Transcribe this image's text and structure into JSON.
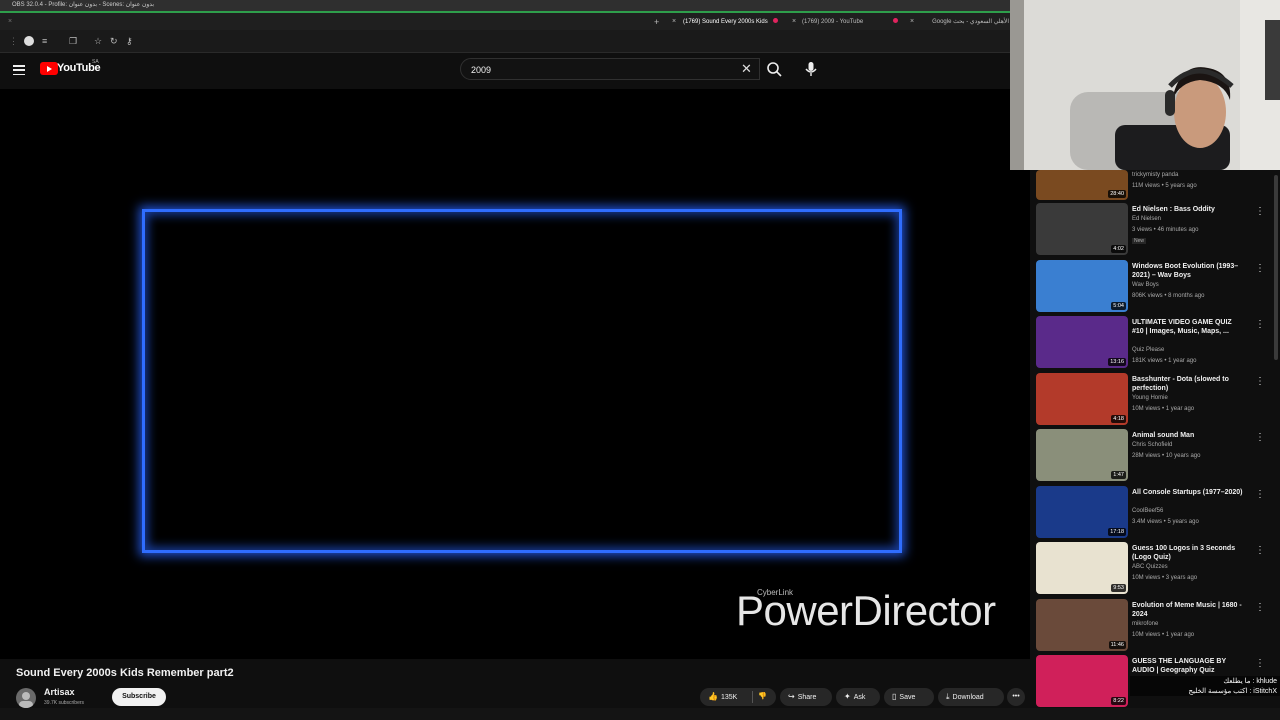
{
  "obs": {
    "title": "OBS 32.0.4 - Profile: بدون عنوان - Scenes: بدون عنوان"
  },
  "browser": {
    "tabs": [
      {
        "label": "(1769) Sound Every 2000s Kids",
        "active": true
      },
      {
        "label": "(1769) 2009 - YouTube",
        "active": false
      },
      {
        "label": "الأهلي السعودي - بحث Google",
        "active": false
      }
    ]
  },
  "youtube": {
    "logo_text": "YouTube",
    "region": "SA",
    "search": {
      "value": "2009",
      "placeholder": "Search"
    },
    "icons": {
      "menu": "menu-icon",
      "clear": "close-icon",
      "search": "search-icon",
      "mic": "microphone-icon"
    }
  },
  "video": {
    "overlay_brand_small": "CyberLink",
    "overlay_brand": "PowerDirector",
    "frame_color": "#2f6dff",
    "title": "Sound Every 2000s Kids Remember part2",
    "channel": {
      "name": "Artisax",
      "subscribers": "39.7K subscribers"
    },
    "subscribe_label": "Subscribe",
    "actions": {
      "like_count": "135K",
      "share": "Share",
      "ask": "Ask",
      "save": "Save",
      "download": "Download"
    }
  },
  "recommendations": [
    {
      "title": "",
      "channel": "trickymisty panda",
      "meta": "11M views • 5 years ago",
      "duration": "28:40",
      "thumb_color": "#7a4a20"
    },
    {
      "title": "Ed Nielsen : Bass Oddity",
      "channel": "Ed Nielsen",
      "meta": "3 views • 46 minutes ago",
      "badge": "New",
      "duration": "4:02",
      "thumb_color": "#3a3a3a"
    },
    {
      "title": "Windows Boot Evolution (1993–2021) – Wav Boys",
      "channel": "Wav Boys",
      "meta": "806K views • 8 months ago",
      "duration": "5:04",
      "thumb_color": "#3a7fd1"
    },
    {
      "title": "ULTIMATE VIDEO GAME QUIZ #10 | Images, Music, Maps, ...",
      "channel": "Quiz Please",
      "meta": "181K views • 1 year ago",
      "duration": "13:16",
      "thumb_color": "#5a2a8a"
    },
    {
      "title": "Basshunter - Dota (slowed to perfection)",
      "channel": "Young Homie",
      "meta": "10M views • 1 year ago",
      "duration": "4:18",
      "thumb_color": "#b33a2a"
    },
    {
      "title": "Animal sound Man",
      "channel": "Chris Schofield",
      "meta": "28M views • 10 years ago",
      "duration": "1:47",
      "thumb_color": "#8a8f7a"
    },
    {
      "title": "All Console Startups (1977–2020)",
      "channel": "CoolBeef56",
      "meta": "3.4M views • 5 years ago",
      "duration": "17:18",
      "thumb_color": "#1a3a8a"
    },
    {
      "title": "Guess 100 Logos in 3 Seconds (Logo Quiz)",
      "channel": "ABC Quizzes",
      "meta": "10M views • 3 years ago",
      "duration": "9:53",
      "thumb_color": "#e8e2d0"
    },
    {
      "title": "Evolution of Meme Music | 1680 - 2024",
      "channel": "mikrofone",
      "meta": "10M views • 1 year ago",
      "duration": "11:46",
      "thumb_color": "#6a4a3a"
    },
    {
      "title": "GUESS THE LANGUAGE BY AUDIO | Geography Quiz",
      "channel": "",
      "meta": "",
      "duration": "8:22",
      "thumb_color": "#d0205a"
    }
  ],
  "chat_overlay": {
    "line1": "khlude : ما يطلعك",
    "line2": "iStitchX : اكتب مؤسسة الخليج"
  }
}
